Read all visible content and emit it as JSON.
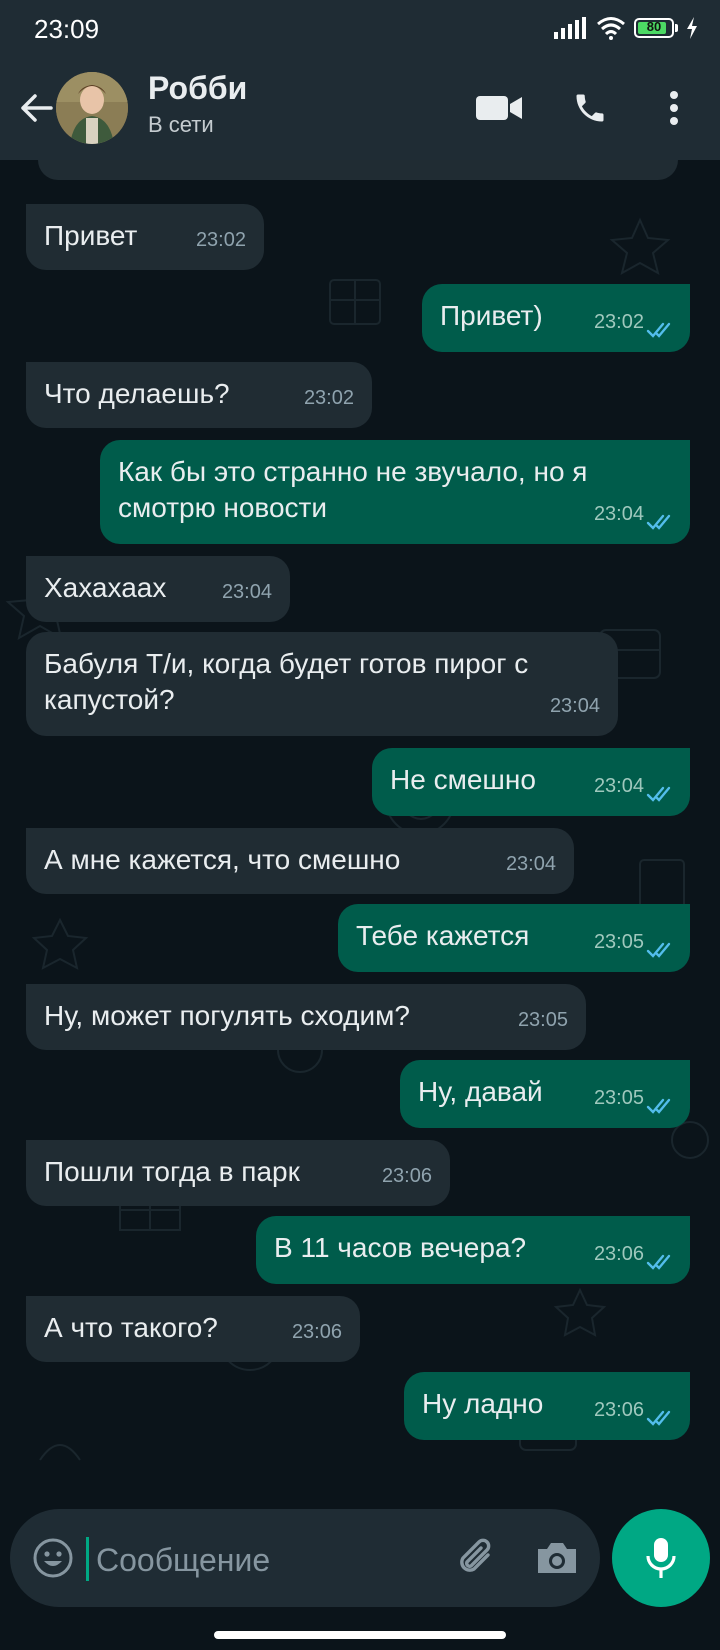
{
  "status_bar": {
    "time": "23:09",
    "battery": "80",
    "icons": [
      "signal-icon",
      "wifi-icon",
      "battery-icon",
      "charging-icon"
    ]
  },
  "header": {
    "contact_name": "Робби",
    "contact_status": "В сети",
    "icons": [
      "back-arrow-icon",
      "video-call-icon",
      "phone-icon",
      "more-vert-icon"
    ]
  },
  "messages": [
    {
      "dir": "in",
      "text": "Привет",
      "time": "23:02"
    },
    {
      "dir": "out",
      "text": "Привет)",
      "time": "23:02",
      "read": true
    },
    {
      "dir": "in",
      "text": "Что делаешь?",
      "time": "23:02"
    },
    {
      "dir": "out",
      "text": "Как бы это странно не звучало, но я смотрю новости",
      "time": "23:04",
      "read": true
    },
    {
      "dir": "in",
      "text": "Хахахаах",
      "time": "23:04"
    },
    {
      "dir": "in",
      "text": "Бабуля Т/и, когда будет готов пирог с капустой?",
      "time": "23:04"
    },
    {
      "dir": "out",
      "text": "Не смешно",
      "time": "23:04",
      "read": true
    },
    {
      "dir": "in",
      "text": "А мне кажется, что смешно",
      "time": "23:04"
    },
    {
      "dir": "out",
      "text": "Тебе кажется",
      "time": "23:05",
      "read": true
    },
    {
      "dir": "in",
      "text": "Ну, может погулять сходим?",
      "time": "23:05"
    },
    {
      "dir": "out",
      "text": "Ну, давай",
      "time": "23:05",
      "read": true
    },
    {
      "dir": "in",
      "text": "Пошли тогда в парк",
      "time": "23:06"
    },
    {
      "dir": "out",
      "text": "В 11 часов вечера?",
      "time": "23:06",
      "read": true
    },
    {
      "dir": "in",
      "text": "А что такого?",
      "time": "23:06"
    },
    {
      "dir": "out",
      "text": "Ну ладно",
      "time": "23:06",
      "read": true
    }
  ],
  "composer": {
    "placeholder": "Сообщение",
    "value": "",
    "icons": [
      "emoji-icon",
      "attach-icon",
      "camera-icon",
      "mic-icon"
    ]
  },
  "colors": {
    "background": "#0b141a",
    "header": "#1f2c34",
    "incoming_bubble": "#202c33",
    "outgoing_bubble": "#005c4b",
    "accent": "#00a884",
    "read_ticks": "#53bdeb"
  }
}
